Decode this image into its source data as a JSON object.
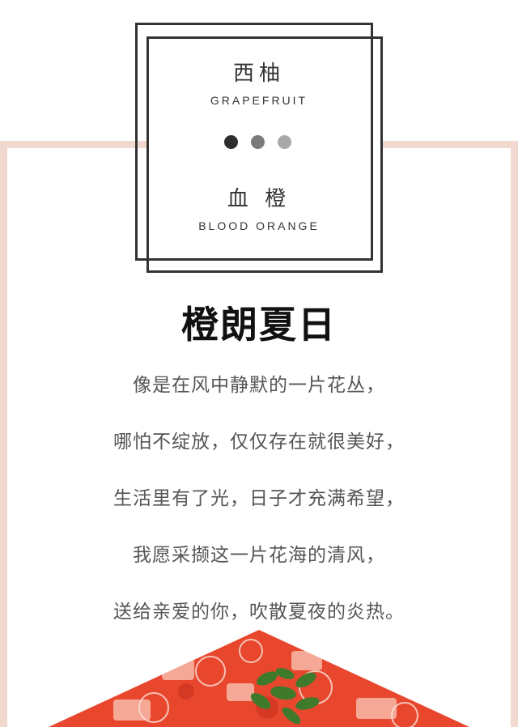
{
  "card": {
    "fruit_1_cn": "西柚",
    "fruit_1_en": "GRAPEFRUIT",
    "fruit_2_cn": "血 橙",
    "fruit_2_en": "BLOOD ORANGE"
  },
  "headline": "橙朗夏日",
  "poem": [
    "像是在风中静默的一片花丛，",
    "哪怕不绽放，仅仅存在就很美好，",
    "生活里有了光，日子才充满希望，",
    "我愿采撷这一片花海的清风，",
    "送给亲爱的你，吹散夏夜的炎热。"
  ],
  "colors": {
    "frame_pink": "#f1d9d0",
    "box_border": "#333333",
    "dot_dark": "#2e2e2e",
    "dot_mid": "#7a7a7a",
    "dot_light": "#a9a9a9",
    "fruit_red": "#e8472e"
  },
  "image": {
    "subject": "sliced-citrus-dessert-with-mint-photo"
  }
}
